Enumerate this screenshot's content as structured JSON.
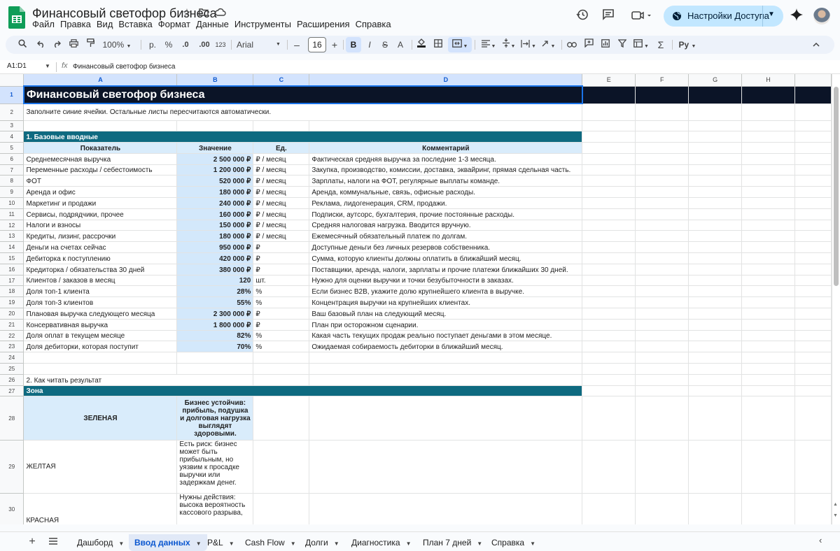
{
  "app": {
    "doc_title": "Финансовый светофор бизнеса",
    "menu": [
      "Файл",
      "Правка",
      "Вид",
      "Вставка",
      "Формат",
      "Данные",
      "Инструменты",
      "Расширения",
      "Справка"
    ],
    "share_label": "Настройки Доступа"
  },
  "toolbar": {
    "zoom": "100%",
    "currency": "р.",
    "percent": "%",
    "dec_decrease": ".0",
    "dec_increase": ".00",
    "format_123": "123",
    "font": "Arial",
    "font_size": "16",
    "bold": "B",
    "italic": "I",
    "strike": "S",
    "text_color": "A"
  },
  "formula_bar": {
    "name_box": "A1:D1",
    "fx": "fx",
    "content": "Финансовый светофор бизнеса"
  },
  "grid": {
    "columns": [
      "A",
      "B",
      "C",
      "D",
      "E",
      "F",
      "G",
      "H"
    ],
    "title": "Финансовый светофор бизнеса",
    "subtitle": "Заполните синие ячейки. Остальные листы пересчитаются автоматически.",
    "section1": "1. Базовые вводные",
    "headers": [
      "Показатель",
      "Значение",
      "Ед.",
      "Комментарий"
    ],
    "rows": [
      {
        "n": "6",
        "label": "Среднемесячная выручка",
        "value": "2 500 000 ₽",
        "unit": "₽ / месяц",
        "comment": "Фактическая средняя выручка за последние 1-3 месяца."
      },
      {
        "n": "7",
        "label": "Переменные расходы / себестоимость",
        "value": "1 200 000 ₽",
        "unit": "₽ / месяц",
        "comment": "Закупка, производство, комиссии, доставка, эквайринг, прямая сдельная часть."
      },
      {
        "n": "8",
        "label": "ФОТ",
        "value": "520 000 ₽",
        "unit": "₽ / месяц",
        "comment": "Зарплаты, налоги на ФОТ, регулярные выплаты команде."
      },
      {
        "n": "9",
        "label": "Аренда и офис",
        "value": "180 000 ₽",
        "unit": "₽ / месяц",
        "comment": "Аренда, коммунальные, связь, офисные расходы."
      },
      {
        "n": "10",
        "label": "Маркетинг и продажи",
        "value": "240 000 ₽",
        "unit": "₽ / месяц",
        "comment": "Реклама, лидогенерация, CRM, продажи."
      },
      {
        "n": "11",
        "label": "Сервисы, подрядчики, прочее",
        "value": "160 000 ₽",
        "unit": "₽ / месяц",
        "comment": "Подписки, аутсорс, бухгалтерия, прочие постоянные расходы."
      },
      {
        "n": "12",
        "label": "Налоги и взносы",
        "value": "150 000 ₽",
        "unit": "₽ / месяц",
        "comment": "Средняя налоговая нагрузка. Вводится вручную."
      },
      {
        "n": "13",
        "label": "Кредиты, лизинг, рассрочки",
        "value": "180 000 ₽",
        "unit": "₽ / месяц",
        "comment": "Ежемесячный обязательный платеж по долгам."
      },
      {
        "n": "14",
        "label": "Деньги на счетах сейчас",
        "value": "950 000 ₽",
        "unit": "₽",
        "comment": "Доступные деньги без личных резервов собственника."
      },
      {
        "n": "15",
        "label": "Дебиторка к поступлению",
        "value": "420 000 ₽",
        "unit": "₽",
        "comment": "Сумма, которую клиенты должны оплатить в ближайший месяц."
      },
      {
        "n": "16",
        "label": "Кредиторка / обязательства 30 дней",
        "value": "380 000 ₽",
        "unit": "₽",
        "comment": "Поставщики, аренда, налоги, зарплаты и прочие платежи ближайших 30 дней."
      },
      {
        "n": "17",
        "label": "Клиентов / заказов в месяц",
        "value": "120",
        "unit": "шт.",
        "comment": "Нужно для оценки выручки и точки безубыточности в заказах."
      },
      {
        "n": "18",
        "label": "Доля топ-1 клиента",
        "value": "28%",
        "unit": "%",
        "comment": "Если бизнес B2B, укажите долю крупнейшего клиента в выручке."
      },
      {
        "n": "19",
        "label": "Доля топ-3 клиентов",
        "value": "55%",
        "unit": "%",
        "comment": "Концентрация выручки на крупнейших клиентах."
      },
      {
        "n": "20",
        "label": "Плановая выручка следующего месяца",
        "value": "2 300 000 ₽",
        "unit": "₽",
        "comment": "Ваш базовый план на следующий месяц."
      },
      {
        "n": "21",
        "label": "Консервативная выручка",
        "value": "1 800 000 ₽",
        "unit": "₽",
        "comment": "План при осторожном сценарии."
      },
      {
        "n": "22",
        "label": "Доля оплат в текущем месяце",
        "value": "82%",
        "unit": "%",
        "comment": "Какая часть текущих продаж реально поступает деньгами в этом месяце."
      },
      {
        "n": "23",
        "label": "Доля дебиторки, которая поступит",
        "value": "70%",
        "unit": "%",
        "comment": "Ожидаемая собираемость дебиторки в ближайший месяц."
      }
    ],
    "section2": "2. Как читать результат",
    "zone_header": "Зона",
    "zones": [
      {
        "n": "28",
        "name": "ЗЕЛЕНАЯ",
        "desc": "Бизнес устойчив: прибыль, подушка и долговая нагрузка выглядят здоровыми."
      },
      {
        "n": "29",
        "name": "ЖЕЛТАЯ",
        "desc": "Есть риск: бизнес может быть прибыльным, но уязвим к просадке выручки или задержкам денег."
      },
      {
        "n": "30",
        "name": "КРАСНАЯ",
        "desc": "Нужны действия: высока вероятность кассового разрыва,"
      }
    ]
  },
  "sheet_tabs": [
    "Дашборд",
    "Ввод данных",
    "P&L",
    "Cash Flow",
    "Долги",
    "Диагностика",
    "План 7 дней",
    "Справка"
  ],
  "active_tab": "Ввод данных",
  "colors": {
    "title_bg": "#0b1427",
    "section_bg": "#0e6a80",
    "input_bg": "#d3e8fb",
    "header_bg": "#d9ecfb",
    "share_bg": "#c2e7ff"
  }
}
